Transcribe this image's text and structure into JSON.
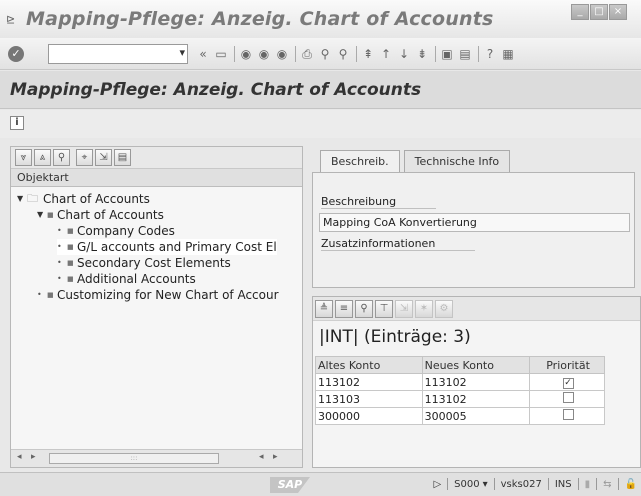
{
  "window": {
    "title": "Mapping-Pflege: Anzeig. Chart of Accounts",
    "buttons": [
      "_",
      "□",
      "×"
    ]
  },
  "toolbar": {
    "command_field_value": "",
    "icons": [
      "enter-icon",
      "save-icon",
      "back-icon",
      "exit-icon",
      "cancel-icon",
      "print-icon",
      "find-icon",
      "find-next-icon",
      "first-page-icon",
      "previous-page-icon",
      "next-page-icon",
      "last-page-icon",
      "new-session-icon",
      "shortcut-icon",
      "help-icon",
      "customize-layout-icon"
    ]
  },
  "page": {
    "title": "Mapping-Pflege: Anzeig. Chart of Accounts",
    "info_button": "i"
  },
  "tree": {
    "column_header": "Objektart",
    "nodes": [
      {
        "label": "Chart of Accounts",
        "level": 0,
        "expanded": true,
        "icon": "folder-icon"
      },
      {
        "label": "Chart of Accounts",
        "level": 1,
        "expanded": true
      },
      {
        "label": "Company Codes",
        "level": 2
      },
      {
        "label": "G/L accounts and Primary Cost El",
        "level": 2,
        "selected": true
      },
      {
        "label": "Secondary Cost Elements",
        "level": 2
      },
      {
        "label": "Additional Accounts",
        "level": 2
      },
      {
        "label": "Customizing for New Chart of Accour",
        "level": 1
      }
    ]
  },
  "tabs": {
    "items": [
      {
        "label": "Beschreib.",
        "active": true
      },
      {
        "label": "Technische Info",
        "active": false
      }
    ]
  },
  "description": {
    "label": "Beschreibung",
    "value": "Mapping CoA Konvertierung",
    "extra_label": "Zusatzinformationen"
  },
  "table": {
    "title": "|INT|  (Einträge: 3)",
    "columns": [
      "Altes Konto",
      "Neues Konto",
      "Priorität"
    ],
    "rows": [
      {
        "old": "113102",
        "new": "113102",
        "priority": true
      },
      {
        "old": "113103",
        "new": "113102",
        "priority": false
      },
      {
        "old": "300000",
        "new": "300005",
        "priority": false
      }
    ]
  },
  "status": {
    "system": "S000",
    "server": "vsks027",
    "mode": "INS",
    "logo": "SAP"
  }
}
